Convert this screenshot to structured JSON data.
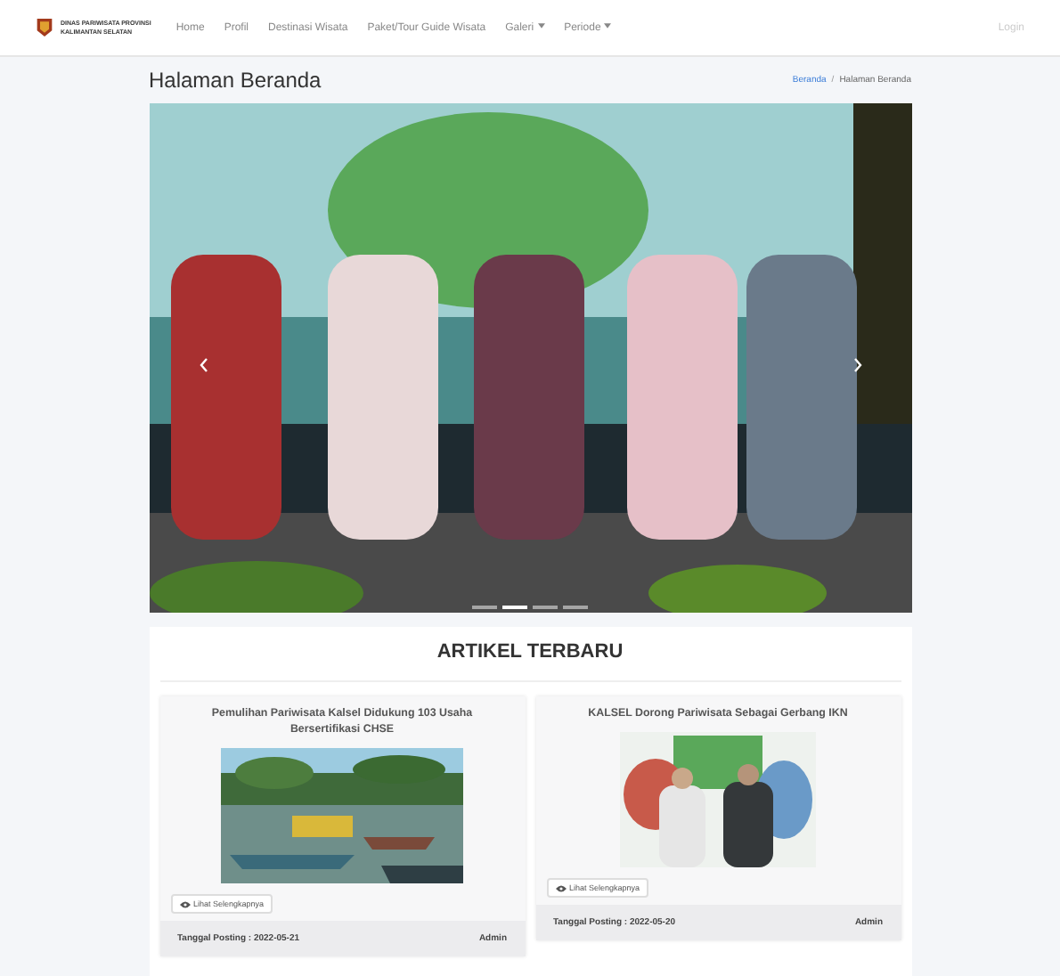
{
  "navbar": {
    "brand_lines": [
      "DINAS PARIWISATA PROVINSI",
      "KALIMANTAN SELATAN"
    ],
    "items": [
      {
        "label": "Home",
        "dropdown": false
      },
      {
        "label": "Profil",
        "dropdown": false
      },
      {
        "label": "Destinasi Wisata",
        "dropdown": false
      },
      {
        "label": "Paket/Tour Guide Wisata",
        "dropdown": false
      },
      {
        "label": "Galeri",
        "dropdown": true
      },
      {
        "label": "Periode",
        "dropdown": true
      }
    ],
    "login": "Login"
  },
  "page_title": "Halaman Beranda",
  "breadcrumb": {
    "separator": "/",
    "items": [
      {
        "label": "Beranda",
        "link": true
      },
      {
        "label": "Halaman Beranda",
        "link": false
      }
    ]
  },
  "carousel": {
    "kind": "picture",
    "indicators": [
      {
        "selected": false
      },
      {
        "selected": true
      },
      {
        "selected": false
      },
      {
        "selected": false
      }
    ]
  },
  "section_title": "ARTIKEL TERBARU",
  "articles": [
    {
      "title": "Pemulihan Pariwisata Kalsel Didukung 103 Usaha Bersertifikasi CHSE",
      "kind": "picture",
      "button": "Lihat Selengkapnya",
      "posted": "Tanggal Posting : 2022-05-21",
      "author": "Admin"
    },
    {
      "title": "KALSEL Dorong Pariwisata Sebagai Gerbang IKN",
      "kind": "picture",
      "button": "Lihat Selengkapnya",
      "posted": "Tanggal Posting : 2022-05-20",
      "author": "Admin"
    }
  ]
}
